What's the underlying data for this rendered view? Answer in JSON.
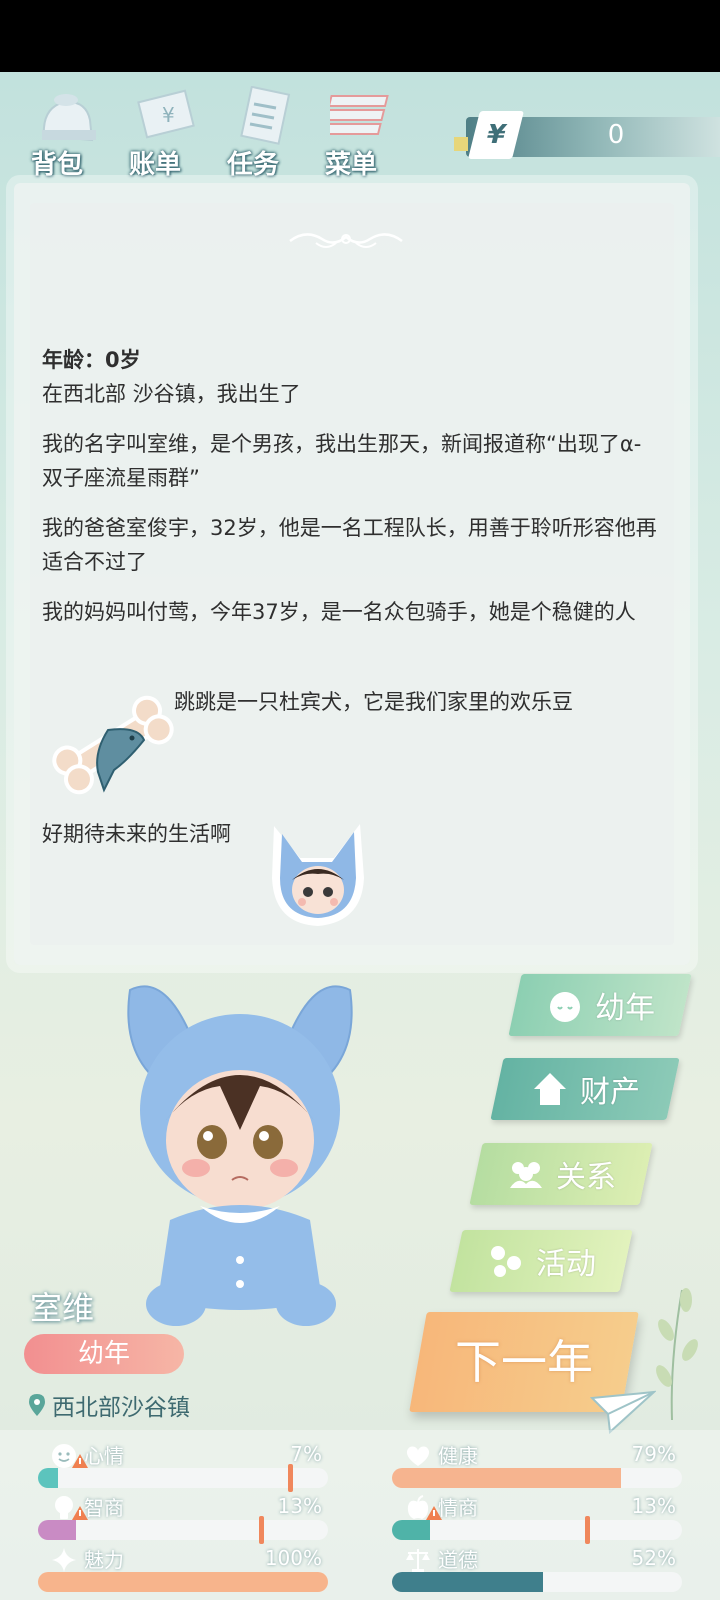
{
  "menu": {
    "bag": "背包",
    "bill": "账单",
    "task": "任务",
    "menu": "菜单"
  },
  "money": {
    "currency": "¥",
    "amount": "0"
  },
  "story": {
    "age": "年龄：0岁",
    "birth": "在西北部 沙谷镇，我出生了",
    "p1": "我的名字叫室维，是个男孩，我出生那天，新闻报道称“出现了α-双子座流星雨群”",
    "p2": "我的爸爸室俊宇，32岁，他是一名工程队长，用善于聆听形容他再适合不过了",
    "p3": "我的妈妈叫付莺，今年37岁，是一名众包骑手，她是个稳健的人",
    "pet": "跳跳是一只杜宾犬，它是我们家里的欢乐豆",
    "future": "好期待未来的生活啊"
  },
  "character": {
    "name": "室维",
    "stage": "幼年",
    "location": "西北部沙谷镇"
  },
  "actions": {
    "youth": "幼年",
    "assets": "财产",
    "relation": "关系",
    "activity": "活动",
    "next_year": "下一年"
  },
  "stats": {
    "mood": {
      "label": "心情",
      "value": "7%",
      "fraction": 0.07,
      "color": "#5cc4bd"
    },
    "health": {
      "label": "健康",
      "value": "79%",
      "fraction": 0.79,
      "color": "#f6b48f"
    },
    "iq": {
      "label": "智商",
      "value": "13%",
      "fraction": 0.13,
      "color": "#c98bc4"
    },
    "eq": {
      "label": "情商",
      "value": "13%",
      "fraction": 0.13,
      "color": "#4fb3a8"
    },
    "charm": {
      "label": "魅力",
      "value": "100%",
      "fraction": 1.0,
      "color": "#f7b48c"
    },
    "morality": {
      "label": "道德",
      "value": "52%",
      "fraction": 0.52,
      "color": "#3f7f8c"
    }
  }
}
